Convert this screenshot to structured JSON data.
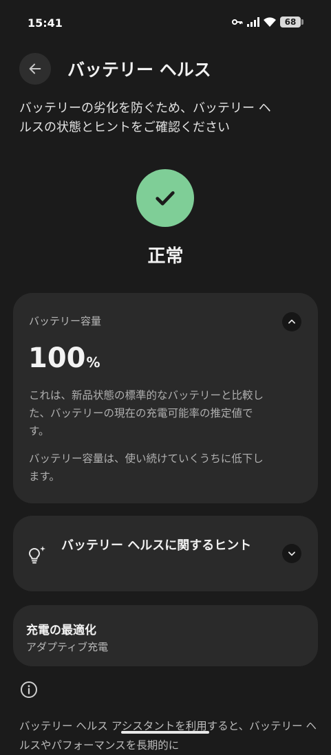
{
  "status_bar": {
    "time": "15:41",
    "battery_level": "68",
    "icons": [
      "vpn-key-icon",
      "signal-icon",
      "wifi-icon",
      "battery-icon"
    ]
  },
  "app_bar": {
    "title": "バッテリー ヘルス",
    "back_icon": "arrow-left-icon"
  },
  "intro": "バッテリーの劣化を防ぐため、バッテリー ヘルスの状態とヒントをご確認ください",
  "health_status": {
    "label": "正常",
    "icon": "check-icon",
    "color": "#7fce97"
  },
  "capacity_card": {
    "title": "バッテリー容量",
    "value": "100",
    "unit": "%",
    "description_1": "これは、新品状態の標準的なバッテリーと比較した、バッテリーの現在の充電可能率の推定値です。",
    "description_2": "バッテリー容量は、使い続けていくうちに低下します。",
    "toggle_icon": "chevron-up-icon"
  },
  "tips_card": {
    "label": "バッテリー ヘルスに関するヒント",
    "icon": "lightbulb-sparkle-icon",
    "toggle_icon": "chevron-down-icon"
  },
  "optimize_card": {
    "title": "充電の最適化",
    "subtitle": "アダプティブ充電"
  },
  "footer": {
    "icon": "info-icon",
    "text": "バッテリー ヘルス アシスタントを利用すると、バッテリー ヘルスやパフォーマンスを長期的に"
  },
  "colors": {
    "background": "#1b1b1b",
    "card": "#2a2a2a",
    "accent": "#7fce97"
  }
}
